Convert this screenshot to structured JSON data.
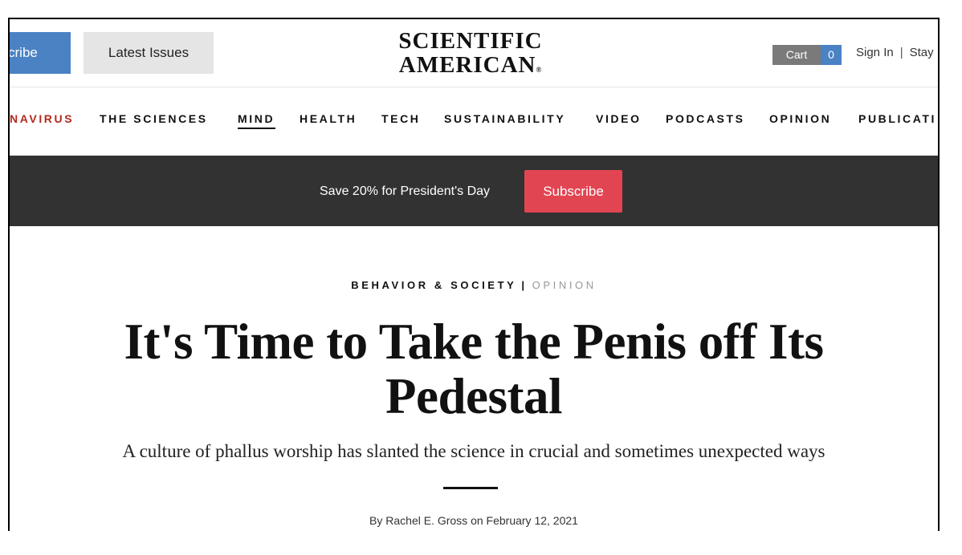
{
  "header": {
    "subscribe_label": "cribe",
    "latest_issues_label": "Latest Issues",
    "logo_line1": "SCIENTIFIC",
    "logo_line2": "AMERICAN",
    "logo_mark": "®",
    "cart_label": "Cart",
    "cart_count": "0",
    "signin_label": "Sign In",
    "separator": "|",
    "stay_label": "Stay"
  },
  "nav": {
    "items": [
      {
        "label": "NAVIRUS",
        "highlight": true
      },
      {
        "label": "THE SCIENCES"
      },
      {
        "label": "MIND",
        "active": true
      },
      {
        "label": "HEALTH"
      },
      {
        "label": "TECH"
      },
      {
        "label": "SUSTAINABILITY"
      },
      {
        "label": "VIDEO"
      },
      {
        "label": "PODCASTS"
      },
      {
        "label": "OPINION"
      },
      {
        "label": "PUBLICATI"
      }
    ]
  },
  "promo": {
    "text": "Save 20% for President's Day",
    "button_label": "Subscribe"
  },
  "article": {
    "category": "BEHAVIOR & SOCIETY",
    "divider": "|",
    "type": "OPINION",
    "headline_line1": "It's Time to Take the Penis off Its",
    "headline_line2": "Pedestal",
    "dek": "A culture of phallus worship has slanted the science in crucial and sometimes unexpected ways",
    "byline": "By Rachel E. Gross on February 12, 2021"
  },
  "colors": {
    "accent_blue": "#4a82c4",
    "promo_bg": "#323232",
    "subscribe_red": "#e24552",
    "nav_highlight_red": "#b2281e"
  }
}
